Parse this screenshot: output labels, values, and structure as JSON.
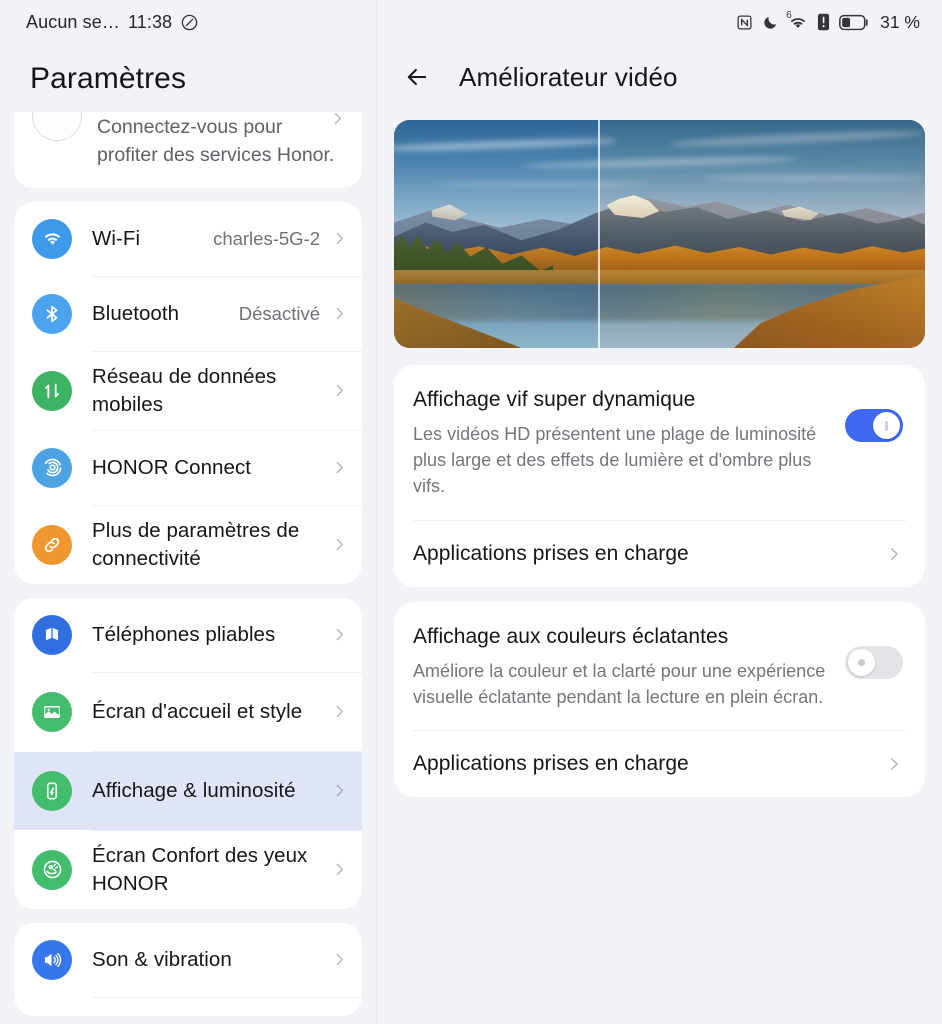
{
  "statusbar": {
    "carrier": "Aucun se…",
    "time": "11:38",
    "dnd_icon": "dnd-circle-icon",
    "icons": [
      "nfc-icon",
      "moon-icon",
      "wifi6-icon",
      "sim-alert-icon",
      "battery-icon"
    ],
    "battery_percent": "31 %",
    "wifi_badge": "6"
  },
  "sidebar": {
    "title": "Paramètres",
    "account": {
      "text": "Connectez-vous pour profiter des services Honor.",
      "avatar": "account-avatar",
      "chevron": "chevron-right-icon"
    },
    "groups": [
      {
        "id": "connectivity",
        "items": [
          {
            "label": "Wi-Fi",
            "value": "charles-5G-2",
            "icon": "wifi-icon",
            "color": "#3d9ae8",
            "selected": false
          },
          {
            "label": "Bluetooth",
            "value": "Désactivé",
            "icon": "bluetooth-icon",
            "color": "#4aa3ec",
            "selected": false
          },
          {
            "label": "Réseau de données mobiles",
            "value": "",
            "icon": "mobile-data-icon",
            "color": "#3cb362",
            "selected": false
          },
          {
            "label": "HONOR Connect",
            "value": "",
            "icon": "honor-connect-icon",
            "color": "#4ba3e3",
            "selected": false
          },
          {
            "label": "Plus de paramètres de connectivité",
            "value": "",
            "icon": "link-icon",
            "color": "#f0962f",
            "selected": false
          }
        ]
      },
      {
        "id": "display",
        "items": [
          {
            "label": "Téléphones pliables",
            "value": "",
            "icon": "foldable-phone-icon",
            "color": "#2f6fe0",
            "selected": false
          },
          {
            "label": "Écran d'accueil et style",
            "value": "",
            "icon": "home-screen-icon",
            "color": "#43bd6c",
            "selected": false
          },
          {
            "label": "Affichage & luminosité",
            "value": "",
            "icon": "display-brightness-icon",
            "color": "#43bd6c",
            "selected": true
          },
          {
            "label": "Écran Confort des yeux HONOR",
            "value": "",
            "icon": "eye-comfort-icon",
            "color": "#43bd6c",
            "selected": false
          }
        ]
      },
      {
        "id": "sound",
        "items": [
          {
            "label": "Son & vibration",
            "value": "",
            "icon": "sound-vibration-icon",
            "color": "#3577ea",
            "selected": false
          }
        ]
      }
    ]
  },
  "content": {
    "back_icon": "back-arrow-icon",
    "title": "Améliorateur vidéo",
    "preview": {
      "name": "video-enhancer-preview",
      "alt": "Paysage de montagne avec lac et arbres d'automne, comparaison avant/après"
    },
    "cards": [
      {
        "id": "super-dynamic-vivid-display",
        "title": "Affichage vif super dynamique",
        "desc": "Les vidéos HD présentent une plage de luminosité plus large et des effets de lumière et d'ombre plus vifs.",
        "toggle_on": true,
        "link_label": "Applications prises en charge"
      },
      {
        "id": "vivid-colour-display",
        "title": "Affichage aux couleurs éclatantes",
        "desc": "Améliore la couleur et la clarté pour une expérience visuelle éclatante pendant la lecture en plein écran.",
        "toggle_on": false,
        "link_label": "Applications prises en charge"
      }
    ]
  },
  "colors": {
    "page_bg": "#f1f3f6",
    "card_bg": "#ffffff",
    "accent": "#3f68f2",
    "selected_row_bg": "#dfe5f7",
    "muted_text": "#74767d"
  }
}
